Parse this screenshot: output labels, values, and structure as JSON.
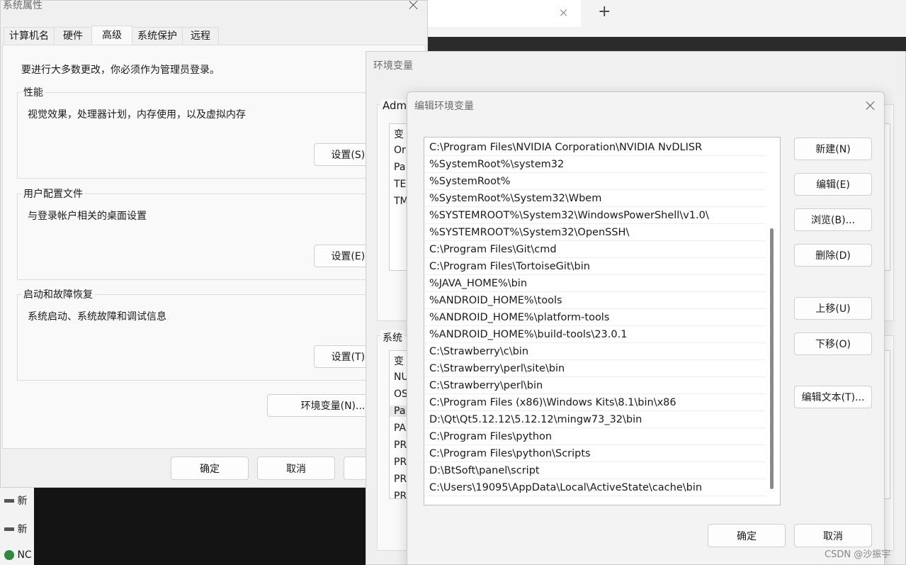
{
  "browser": {
    "new_tab_label": "+"
  },
  "system_props": {
    "title": "系统属性",
    "tabs": [
      "计算机名",
      "硬件",
      "高级",
      "系统保护",
      "远程"
    ],
    "admin_note": "要进行大多数更改，你必须作为管理员登录。",
    "performance": {
      "legend": "性能",
      "desc": "视觉效果，处理器计划，内存使用，以及虚拟内存",
      "button": "设置(S)..."
    },
    "profile": {
      "legend": "用户配置文件",
      "desc": "与登录帐户相关的桌面设置",
      "button": "设置(E)..."
    },
    "startup": {
      "legend": "启动和故障恢复",
      "desc": "系统启动、系统故障和调试信息",
      "button": "设置(T)..."
    },
    "env_button": "环境变量(N)...",
    "ok": "确定",
    "cancel": "取消"
  },
  "env_vars": {
    "title": "环境变量",
    "user_section": "Adm",
    "user_header": "变",
    "user_rows": [
      "Or",
      "Pa",
      "TE",
      "TM"
    ],
    "sys_section": "系统",
    "sys_header": "变",
    "sys_rows": [
      "NU",
      "OS",
      "Pa",
      "PA",
      "PR",
      "PR",
      "PR",
      "PR"
    ]
  },
  "edit_env": {
    "title": "编辑环境变量",
    "paths": [
      "C:\\Program Files\\NVIDIA Corporation\\NVIDIA NvDLISR",
      "%SystemRoot%\\system32",
      "%SystemRoot%",
      "%SystemRoot%\\System32\\Wbem",
      "%SYSTEMROOT%\\System32\\WindowsPowerShell\\v1.0\\",
      "%SYSTEMROOT%\\System32\\OpenSSH\\",
      "C:\\Program Files\\Git\\cmd",
      "C:\\Program Files\\TortoiseGit\\bin",
      "%JAVA_HOME%\\bin",
      "%ANDROID_HOME%\\tools",
      "%ANDROID_HOME%\\platform-tools",
      "%ANDROID_HOME%\\build-tools\\23.0.1",
      "C:\\Strawberry\\c\\bin",
      "C:\\Strawberry\\perl\\site\\bin",
      "C:\\Strawberry\\perl\\bin",
      "C:\\Program Files (x86)\\Windows Kits\\8.1\\bin\\x86",
      "D:\\Qt\\Qt5.12.12\\5.12.12\\mingw73_32\\bin",
      "C:\\Program Files\\python",
      "C:\\Program Files\\python\\Scripts",
      "D:\\BtSoft\\panel\\script",
      "C:\\Users\\19095\\AppData\\Local\\ActiveState\\cache\\bin"
    ],
    "buttons": {
      "new": "新建(N)",
      "edit": "编辑(E)",
      "browse": "浏览(B)...",
      "delete": "删除(D)",
      "up": "上移(U)",
      "down": "下移(O)",
      "edit_text": "编辑文本(T)..."
    },
    "ok": "确定",
    "cancel": "取消"
  },
  "taskbar_items": [
    "新",
    "新",
    "NC"
  ],
  "watermark": "CSDN @沙振宇"
}
